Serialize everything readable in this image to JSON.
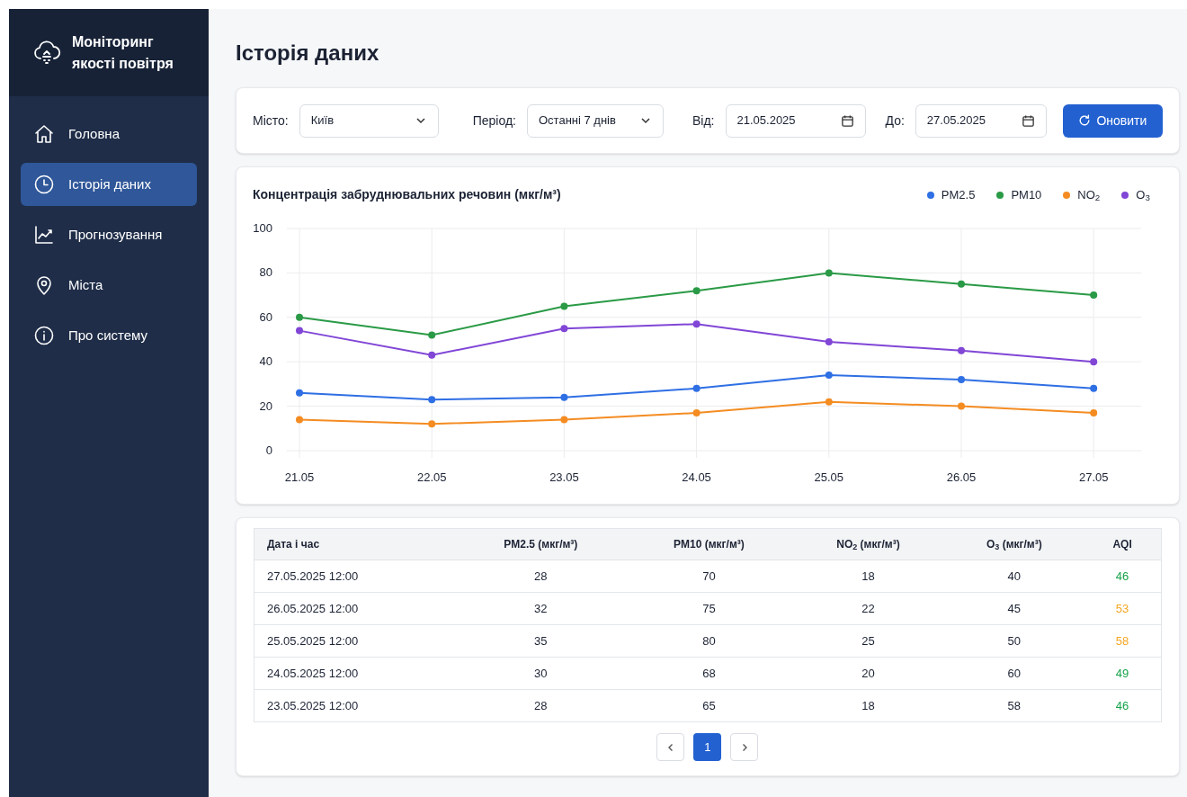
{
  "app": {
    "title_lines": [
      "Моніторинг",
      "якості повітря"
    ]
  },
  "sidebar": {
    "items": [
      {
        "label": "Головна",
        "selected": false
      },
      {
        "label": "Історія даних",
        "selected": true
      },
      {
        "label": "Прогнозування",
        "selected": false
      },
      {
        "label": "Міста",
        "selected": false
      },
      {
        "label": "Про систему",
        "selected": false
      }
    ]
  },
  "page_title": "Історія даних",
  "filters": [
    {
      "kind": "select",
      "label": "Місто:",
      "value": "Київ"
    },
    {
      "kind": "select",
      "label": "Період:",
      "value": "Останні 7 днів"
    },
    {
      "kind": "date",
      "label": "Від:",
      "value": "21.05.2025"
    },
    {
      "kind": "date",
      "label": "До:",
      "value": "27.05.2025"
    }
  ],
  "refresh_button": "Оновити",
  "chart": {
    "chart_data": {
      "type": "line",
      "title": "Концентрація забруднювальних речовин (мкг/м³)",
      "categories": [
        "21.05",
        "22.05",
        "23.05",
        "24.05",
        "25.05",
        "26.05",
        "27.05"
      ],
      "ylim": [
        0,
        100
      ],
      "yticks": [
        0,
        20,
        40,
        60,
        80,
        100
      ],
      "grid": true,
      "series": [
        {
          "name": "PM2.5",
          "color": "#2f6fe4",
          "marker": "circle",
          "values": [
            26,
            23,
            24,
            28,
            34,
            32,
            28
          ]
        },
        {
          "name": "PM10",
          "color": "#2a9a46",
          "marker": "circle",
          "values": [
            60,
            52,
            65,
            72,
            80,
            75,
            70
          ]
        },
        {
          "name": "NO$_{2}$",
          "color": "#f48c22",
          "marker": "circle",
          "values": [
            14,
            12,
            14,
            17,
            22,
            20,
            17
          ]
        },
        {
          "name": "O$_{3}$",
          "color": "#8146d6",
          "marker": "circle",
          "values": [
            54,
            43,
            55,
            57,
            49,
            45,
            40
          ]
        }
      ]
    }
  },
  "table": {
    "columns": [
      "Дата і час",
      "PM2.5 (мкг/м³)",
      "PM10 (мкг/м³)",
      "NO$_{2}$ (мкг/м³)",
      "O$_{3}$ (мкг/м³)",
      "AQI"
    ],
    "rows": [
      {
        "cells": [
          "27.05.2025 12:00",
          "28",
          "70",
          "18",
          "40",
          "46"
        ],
        "color": "#16a34a"
      },
      {
        "cells": [
          "26.05.2025 12:00",
          "32",
          "75",
          "22",
          "45",
          "53"
        ],
        "color": "#f5a623"
      },
      {
        "cells": [
          "25.05.2025 12:00",
          "35",
          "80",
          "25",
          "50",
          "58"
        ],
        "color": "#f5a623"
      },
      {
        "cells": [
          "24.05.2025 12:00",
          "30",
          "68",
          "20",
          "60",
          "49"
        ],
        "color": "#16a34a"
      },
      {
        "cells": [
          "23.05.2025 12:00",
          "28",
          "65",
          "18",
          "58",
          "46"
        ],
        "color": "#16a34a"
      }
    ]
  },
  "pagination": {
    "pages": [
      {
        "label": "1",
        "selected": true
      }
    ]
  }
}
